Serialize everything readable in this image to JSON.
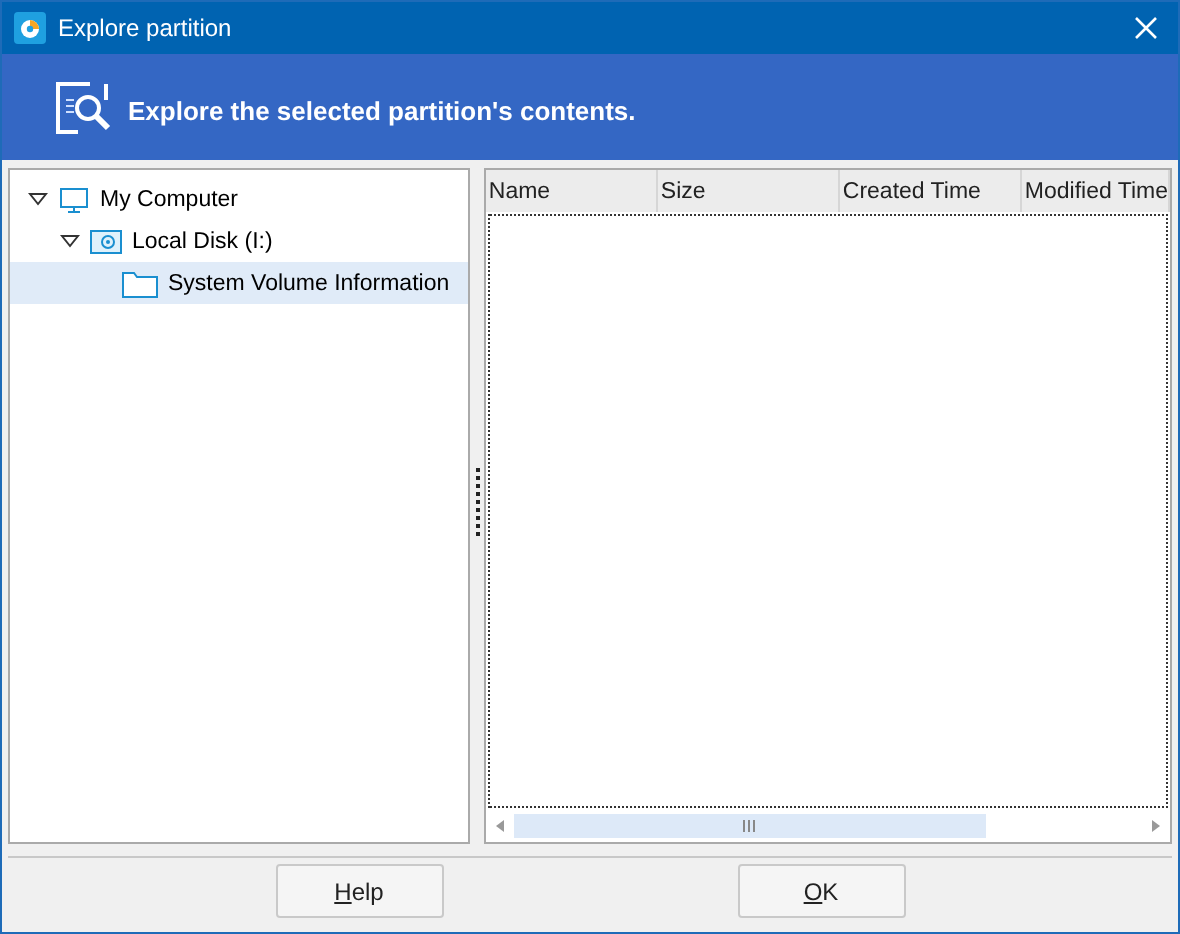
{
  "window": {
    "title": "Explore partition"
  },
  "header": {
    "text": "Explore the selected partition's contents."
  },
  "tree": [
    {
      "label": "My Computer",
      "kind": "computer",
      "expanded": true,
      "selected": false,
      "children": [
        {
          "label": "Local Disk (I:)",
          "kind": "disk",
          "expanded": true,
          "selected": false,
          "children": [
            {
              "label": "System Volume Information",
              "kind": "folder",
              "selected": true
            }
          ]
        }
      ]
    }
  ],
  "table": {
    "columns": [
      "Name",
      "Size",
      "Created Time",
      "Modified Time"
    ]
  },
  "buttons": [
    {
      "label": "Help"
    },
    {
      "label": "OK"
    }
  ]
}
